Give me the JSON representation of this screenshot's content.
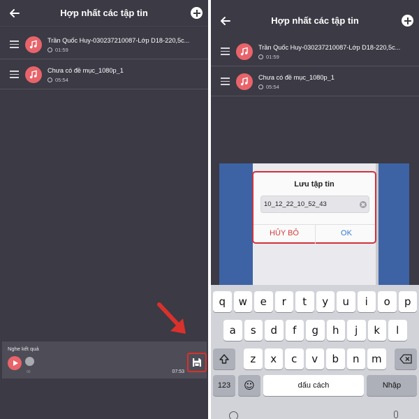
{
  "left": {
    "header": {
      "title": "Hợp nhất các tập tin"
    },
    "items": [
      {
        "name": "Trần Quốc Huy-030237210087-Lớp D18-220,5c...",
        "duration": "01:59"
      },
      {
        "name": "Chưa có đề mục_1080p_1",
        "duration": "05:54"
      }
    ],
    "player": {
      "label": "Nghe kết quả",
      "current_time": "00",
      "total_time": "07:53"
    }
  },
  "right": {
    "header": {
      "title": "Hợp nhất các tập tin"
    },
    "items": [
      {
        "name": "Trần Quốc Huy-030237210087-Lớp D18-220,5c...",
        "duration": "01:59"
      },
      {
        "name": "Chưa có đề mục_1080p_1",
        "duration": "05:54"
      }
    ],
    "dialog": {
      "title": "Lưu tập tin",
      "filename": "10_12_22_10_52_43",
      "cancel_label": "HỦY BỎ",
      "ok_label": "OK"
    },
    "keyboard": {
      "row1": [
        "q",
        "w",
        "e",
        "r",
        "t",
        "y",
        "u",
        "i",
        "o",
        "p"
      ],
      "row2": [
        "a",
        "s",
        "d",
        "f",
        "g",
        "h",
        "j",
        "k",
        "l"
      ],
      "row3": [
        "z",
        "x",
        "c",
        "v",
        "b",
        "n",
        "m"
      ],
      "numbers_label": "123",
      "emoji_icon": "☺",
      "space_label": "dấu cách",
      "return_label": "Nhập"
    }
  },
  "colors": {
    "background": "#3b3a45",
    "accent": "#e8646a",
    "highlight": "#d9312b",
    "ok": "#3279d6"
  }
}
